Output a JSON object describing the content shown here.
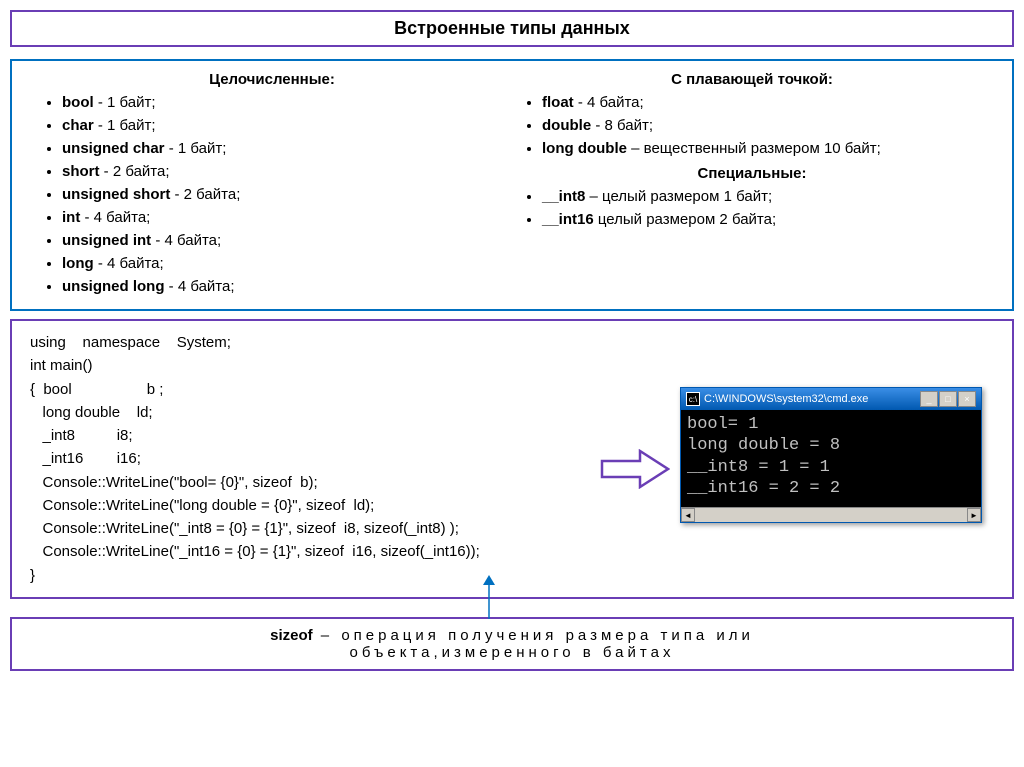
{
  "title": "Встроенные типы данных",
  "integer_heading": "Целочисленные:",
  "integer_types": [
    {
      "name": "bool",
      "desc": "   -  1 байт;"
    },
    {
      "name": "char",
      "desc": "   - 1 байт;"
    },
    {
      "name": "unsigned  char",
      "desc": "    - 1 байт;"
    },
    {
      "name": "short",
      "desc": "  - 2 байта;"
    },
    {
      "name": "unsigned  short",
      "desc": " - 2 байта;"
    },
    {
      "name": "int",
      "desc": "      - 4 байта;"
    },
    {
      "name": "unsigned  int",
      "desc": "      - 4 байта;"
    },
    {
      "name": "long",
      "desc": "    - 4 байта;"
    },
    {
      "name": "unsigned  long",
      "desc": " - 4 байта;"
    }
  ],
  "float_heading": "С плавающей точкой:",
  "float_types": [
    {
      "name": "float",
      "desc": "   - 4 байта;"
    },
    {
      "name": "double",
      "desc": " - 8 байт;"
    },
    {
      "name": "long double",
      "desc": " – вещественный размером 10 байт;"
    }
  ],
  "special_heading": "Специальные:",
  "special_types": [
    {
      "name": "__int8",
      "desc": " – целый размером 1 байт;"
    },
    {
      "name": "__int16",
      "desc": " целый размером 2 байта;"
    }
  ],
  "code": "using    namespace    System;\nint main()\n{  bool                  b ;\n   long double    ld;\n   _int8          i8;\n   _int16        i16;\n   Console::WriteLine(\"bool= {0}\", sizeof  b);\n   Console::WriteLine(\"long double = {0}\", sizeof  ld);\n   Console::WriteLine(\"_int8 = {0} = {1}\", sizeof  i8, sizeof(_int8) );\n   Console::WriteLine(\"_int16 = {0} = {1}\", sizeof  i16, sizeof(_int16));\n}",
  "cmd_title": "C:\\WINDOWS\\system32\\cmd.exe",
  "cmd_output": "bool= 1\nlong double = 8\n__int8 = 1 = 1\n__int16 = 2 = 2",
  "sizeof_kw": "sizeof",
  "sizeof_desc1": " – операция получения размера типа или",
  "sizeof_desc2": "объекта,измеренного в байтах"
}
